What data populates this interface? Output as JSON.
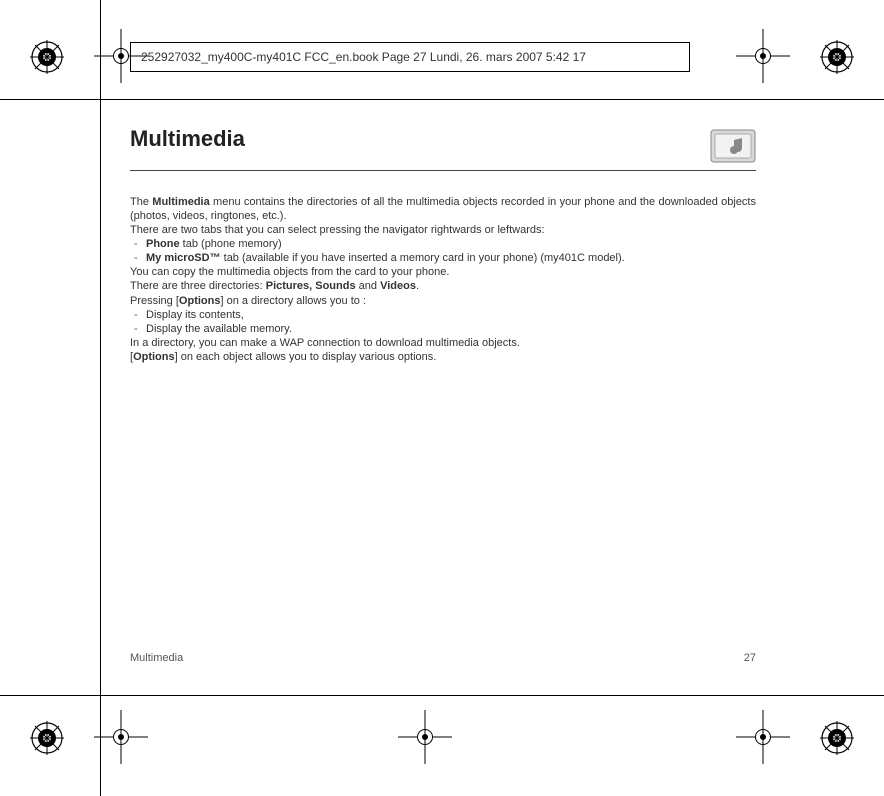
{
  "header": {
    "line": "252927032_my400C-my401C FCC_en.book  Page 27  Lundi, 26. mars 2007  5:42 17"
  },
  "title": "Multimedia",
  "body": {
    "intro_pre": "The ",
    "intro_bold": "Multimedia",
    "intro_post": " menu contains the directories of all the multimedia objects recorded in your phone and the downloaded objects (photos, videos, ringtones, etc.).",
    "tabs_intro": "There are two tabs that you can select pressing the navigator rightwards or leftwards:",
    "tab1_bold": "Phone",
    "tab1_post": " tab (phone memory)",
    "tab2_bold": "My microSD™",
    "tab2_post": "  tab (available if you have inserted a memory card in your phone) (my401C model).",
    "copy_line": "You can copy the multimedia objects from the card to your phone.",
    "dirs_pre": "There are three directories: ",
    "dirs_bold1": "Pictures, Sounds",
    "dirs_mid": " and ",
    "dirs_bold2": "Videos",
    "dirs_post": ".",
    "pressing_pre": "Pressing [",
    "pressing_bold": "Options",
    "pressing_post": "] on a directory allows you to :",
    "opt1": "Display its contents,",
    "opt2": "Display the available memory.",
    "wap_line": "In a directory, you can make a WAP connection to download multimedia objects.",
    "options_each_pre": "[",
    "options_each_bold": "Options",
    "options_each_post": "] on each object allows you to display various options."
  },
  "footer": {
    "section": "Multimedia",
    "page": "27"
  }
}
